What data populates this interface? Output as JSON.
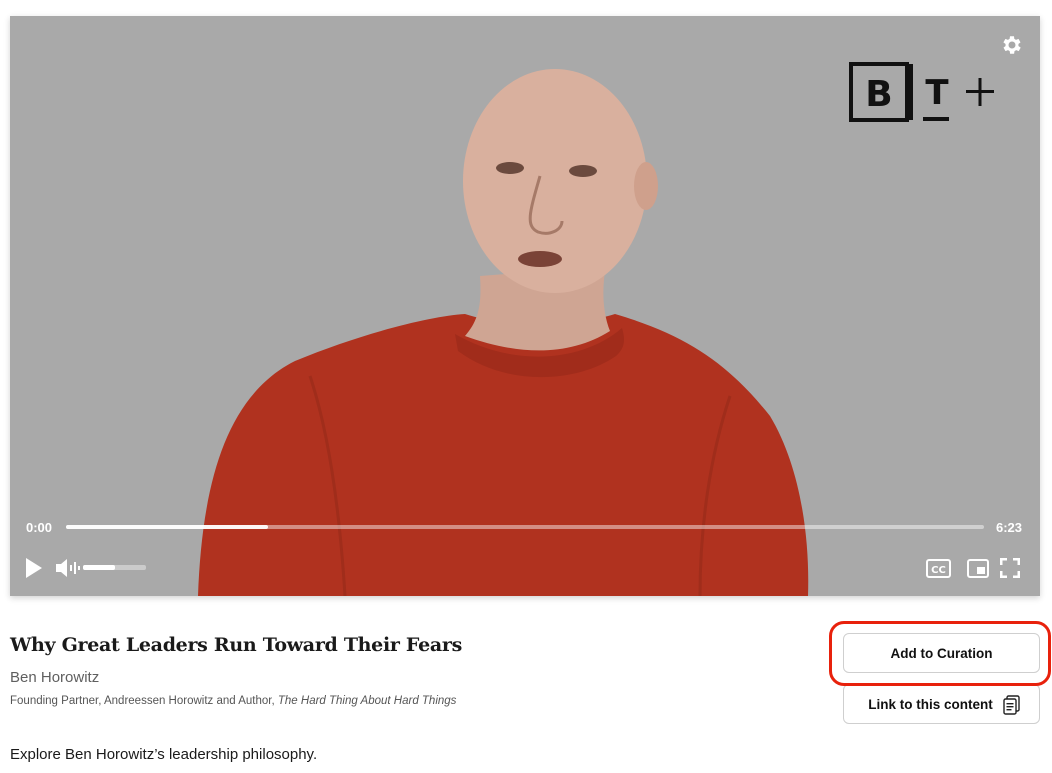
{
  "player": {
    "current_time": "0:00",
    "duration": "6:23",
    "progress_loaded": 0.22,
    "volume_level": 0.5,
    "icons": {
      "settings": "gear-icon",
      "play": "play-icon",
      "mute": "speaker-muted-icon",
      "captions": "closed-captions-icon",
      "pip": "picture-in-picture-icon",
      "fullscreen": "fullscreen-icon"
    },
    "brand_logo": "BT+ logo"
  },
  "content": {
    "title": "Why Great Leaders Run Toward Their Fears",
    "author": "Ben Horowitz",
    "role_prefix": "Founding Partner, Andreessen Horowitz and Author, ",
    "book_title": "The Hard Thing About Hard Things",
    "description": "Explore Ben Horowitz’s leadership philosophy."
  },
  "actions": {
    "add_to_curation_label": "Add to Curation",
    "link_to_content_label": "Link to this content",
    "link_icon": "clipboard-icon",
    "highlight_color": "#e8210c"
  }
}
